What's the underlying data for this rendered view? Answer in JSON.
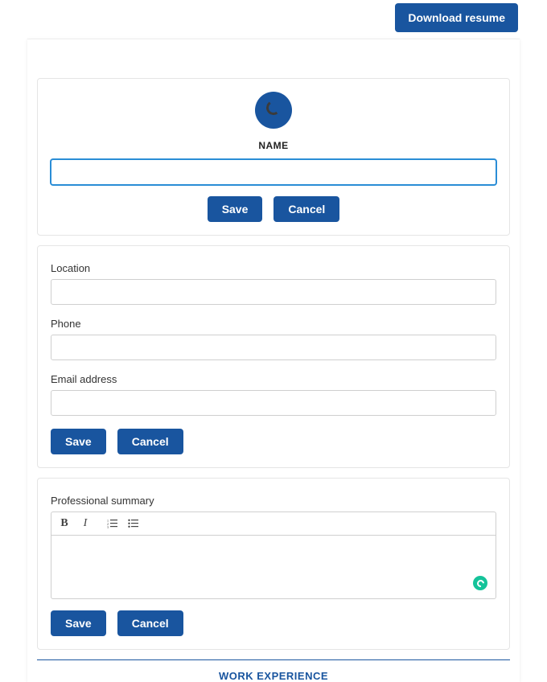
{
  "header": {
    "download_label": "Download resume"
  },
  "name_section": {
    "label": "NAME",
    "value": "",
    "save_label": "Save",
    "cancel_label": "Cancel"
  },
  "contact_section": {
    "location_label": "Location",
    "location_value": "",
    "phone_label": "Phone",
    "phone_value": "",
    "email_label": "Email address",
    "email_value": "",
    "save_label": "Save",
    "cancel_label": "Cancel"
  },
  "summary_section": {
    "label": "Professional summary",
    "value": "",
    "save_label": "Save",
    "cancel_label": "Cancel"
  },
  "work_experience": {
    "title": "WORK EXPERIENCE"
  }
}
